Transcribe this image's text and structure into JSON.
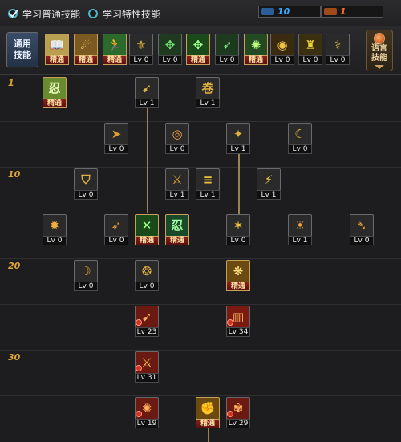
{
  "topbar": {
    "tabs": [
      {
        "label": "学习普通技能",
        "checked": true
      },
      {
        "label": "学习特性技能",
        "checked": false
      }
    ],
    "sp": {
      "value": "10",
      "color": "#3aa6ff"
    },
    "tp": {
      "value": "1",
      "color": "#ff6a2a"
    }
  },
  "quickbar": {
    "general_button": {
      "line1": "通用",
      "line2": "技能"
    },
    "lang_button": {
      "line1": "语言",
      "line2": "技能"
    },
    "slots": [
      {
        "icon": "book-icon",
        "glyph": "📖",
        "bg": "#b8a050",
        "fg": "#1a1a1a",
        "label": "精通",
        "mastered": true
      },
      {
        "icon": "leap-icon",
        "glyph": "☄",
        "bg": "#7a5a20",
        "fg": "#ffd070",
        "label": "精通",
        "mastered": true
      },
      {
        "icon": "run-icon",
        "glyph": "🏃",
        "bg": "#2a6a2a",
        "fg": "#e0ffe0",
        "label": "精通",
        "mastered": true
      },
      {
        "icon": "wings-icon",
        "glyph": "⚜",
        "bg": "#2a2a2a",
        "fg": "#e0b040",
        "label": "Lv 0",
        "mastered": false
      },
      {
        "icon": "sight-icon",
        "glyph": "✥",
        "bg": "#203a20",
        "fg": "#70e070",
        "label": "Lv 0",
        "mastered": false
      },
      {
        "icon": "target-icon",
        "glyph": "✥",
        "bg": "#1a4a1a",
        "fg": "#a0ff90",
        "label": "精通",
        "mastered": true
      },
      {
        "icon": "slide-icon",
        "glyph": "➶",
        "bg": "#1e3a1e",
        "fg": "#90ff90",
        "label": "Lv 0",
        "mastered": false
      },
      {
        "icon": "kick-icon",
        "glyph": "✺",
        "bg": "#244a24",
        "fg": "#c0ff80",
        "label": "精通",
        "mastered": true
      },
      {
        "icon": "eye-icon",
        "glyph": "◉",
        "bg": "#3a2a10",
        "fg": "#f0c040",
        "label": "Lv 0",
        "mastered": false
      },
      {
        "icon": "warrior-icon",
        "glyph": "♜",
        "bg": "#3a3010",
        "fg": "#f0d040",
        "label": "Lv 0",
        "mastered": false
      },
      {
        "icon": "wing-icon",
        "glyph": "⚕",
        "bg": "#2a2a2a",
        "fg": "#e0c060",
        "label": "Lv 0",
        "mastered": false
      }
    ]
  },
  "tree": {
    "levels": [
      "1",
      "10",
      "20",
      "30"
    ],
    "skills": [
      {
        "icon": "jade-book-icon",
        "glyph": "忍",
        "bg": "#6a8a30",
        "fg": "#ecffc0",
        "label": "精通",
        "mastered": true,
        "badge": false
      },
      {
        "icon": "kunai-icon",
        "glyph": "➹",
        "bg": "#2a2a2a",
        "fg": "#e0b040",
        "label": "Lv 1",
        "mastered": false,
        "badge": false
      },
      {
        "icon": "scroll-icon",
        "glyph": "卷",
        "bg": "#2a2a2a",
        "fg": "#e0b040",
        "label": "Lv 1",
        "mastered": false,
        "badge": false
      },
      {
        "icon": "dash-icon",
        "glyph": "➤",
        "bg": "#2a2a2a",
        "fg": "#e0a030",
        "label": "Lv 0",
        "mastered": false,
        "badge": false
      },
      {
        "icon": "fireball-icon",
        "glyph": "◎",
        "bg": "#2a2a2a",
        "fg": "#f0a040",
        "label": "Lv 0",
        "mastered": false,
        "badge": false
      },
      {
        "icon": "ninja-icon",
        "glyph": "✦",
        "bg": "#2a2a2a",
        "fg": "#e0b040",
        "label": "Lv 1",
        "mastered": false,
        "badge": false
      },
      {
        "icon": "crescent-icon",
        "glyph": "☾",
        "bg": "#2a2a2a",
        "fg": "#f0c040",
        "label": "Lv 0",
        "mastered": false,
        "badge": false
      },
      {
        "icon": "shield-icon",
        "glyph": "⛉",
        "bg": "#2a2a2a",
        "fg": "#e0b040",
        "label": "Lv 0",
        "mastered": false,
        "badge": false
      },
      {
        "icon": "twin-strike-icon",
        "glyph": "⚔",
        "bg": "#2a2a2a",
        "fg": "#e0a030",
        "label": "Lv 1",
        "mastered": false,
        "badge": false
      },
      {
        "icon": "wind-slash-icon",
        "glyph": "≡",
        "bg": "#2a2a2a",
        "fg": "#f0c040",
        "label": "Lv 1",
        "mastered": false,
        "badge": false
      },
      {
        "icon": "lightning-icon",
        "glyph": "⚡",
        "bg": "#2a2a2a",
        "fg": "#f0d040",
        "label": "Lv 1",
        "mastered": false,
        "badge": false
      },
      {
        "icon": "flame-burst-icon",
        "glyph": "✹",
        "bg": "#2a2a2a",
        "fg": "#f0b040",
        "label": "Lv 0",
        "mastered": false,
        "badge": false
      },
      {
        "icon": "spear-icon",
        "glyph": "➶",
        "bg": "#2a2a2a",
        "fg": "#e0a030",
        "label": "Lv 0",
        "mastered": false,
        "badge": false
      },
      {
        "icon": "green-slash-icon",
        "glyph": "✕",
        "bg": "#1a4a1a",
        "fg": "#a0ff80",
        "label": "精通",
        "mastered": true,
        "badge": false
      },
      {
        "icon": "green-seal-icon",
        "glyph": "忍",
        "bg": "#1a4a2a",
        "fg": "#a0ffa0",
        "label": "精通",
        "mastered": true,
        "badge": false
      },
      {
        "icon": "fire-kick-icon",
        "glyph": "✶",
        "bg": "#2a2a2a",
        "fg": "#f0c040",
        "label": "Lv 0",
        "mastered": false,
        "badge": false
      },
      {
        "icon": "fire-mage-icon",
        "glyph": "☀",
        "bg": "#2a2a2a",
        "fg": "#f0a040",
        "label": "Lv 1",
        "mastered": false,
        "badge": false
      },
      {
        "icon": "feather-icon",
        "glyph": "➴",
        "bg": "#2a2a2a",
        "fg": "#e0a030",
        "label": "Lv 0",
        "mastered": false,
        "badge": false
      },
      {
        "icon": "claw-icon",
        "glyph": "☽",
        "bg": "#2a2a2a",
        "fg": "#e0a030",
        "label": "Lv 0",
        "mastered": false,
        "badge": false
      },
      {
        "icon": "vortex-icon",
        "glyph": "❂",
        "bg": "#2a2a2a",
        "fg": "#e0b040",
        "label": "Lv 0",
        "mastered": false,
        "badge": false
      },
      {
        "icon": "golden-burst-icon",
        "glyph": "❋",
        "bg": "#6a4a10",
        "fg": "#ffe080",
        "label": "精通",
        "mastered": true,
        "badge": false
      },
      {
        "icon": "red-spear-icon",
        "glyph": "➹",
        "bg": "#6a1a10",
        "fg": "#ffb060",
        "label": "Lv 23",
        "mastered": false,
        "badge": true
      },
      {
        "icon": "red-pillar-icon",
        "glyph": "▥",
        "bg": "#7a1a10",
        "fg": "#ffc060",
        "label": "Lv 34",
        "mastered": false,
        "badge": true
      },
      {
        "icon": "red-blade-icon",
        "glyph": "⚔",
        "bg": "#6a1a10",
        "fg": "#ffc060",
        "label": "Lv 31",
        "mastered": false,
        "badge": true
      },
      {
        "icon": "red-storm-icon",
        "glyph": "✺",
        "bg": "#6a1a10",
        "fg": "#ffb060",
        "label": "Lv 19",
        "mastered": false,
        "badge": true
      },
      {
        "icon": "golden-fist-icon",
        "glyph": "✊",
        "bg": "#6a4a10",
        "fg": "#ffe080",
        "label": "精通",
        "mastered": true,
        "badge": false
      },
      {
        "icon": "red-phoenix-icon",
        "glyph": "✾",
        "bg": "#6a1a10",
        "fg": "#ffb060",
        "label": "Lv 29",
        "mastered": false,
        "badge": true
      }
    ]
  }
}
